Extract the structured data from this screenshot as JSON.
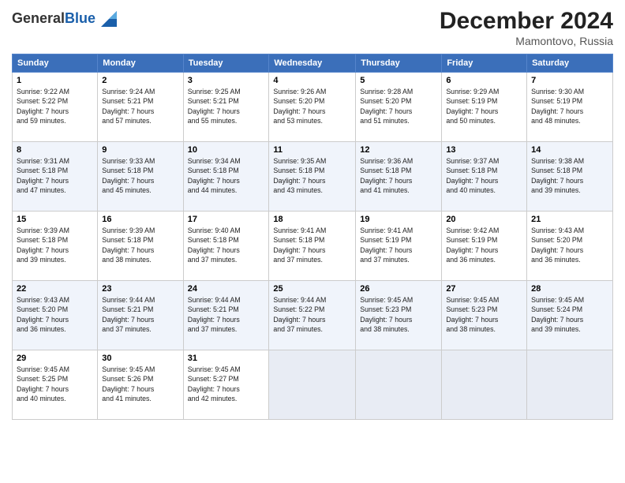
{
  "logo": {
    "general": "General",
    "blue": "Blue"
  },
  "title": "December 2024",
  "location": "Mamontovo, Russia",
  "days_of_week": [
    "Sunday",
    "Monday",
    "Tuesday",
    "Wednesday",
    "Thursday",
    "Friday",
    "Saturday"
  ],
  "weeks": [
    [
      {
        "day": "1",
        "sunrise": "9:22 AM",
        "sunset": "5:22 PM",
        "daylight_hours": "7",
        "daylight_minutes": "59"
      },
      {
        "day": "2",
        "sunrise": "9:24 AM",
        "sunset": "5:21 PM",
        "daylight_hours": "7",
        "daylight_minutes": "57"
      },
      {
        "day": "3",
        "sunrise": "9:25 AM",
        "sunset": "5:21 PM",
        "daylight_hours": "7",
        "daylight_minutes": "55"
      },
      {
        "day": "4",
        "sunrise": "9:26 AM",
        "sunset": "5:20 PM",
        "daylight_hours": "7",
        "daylight_minutes": "53"
      },
      {
        "day": "5",
        "sunrise": "9:28 AM",
        "sunset": "5:20 PM",
        "daylight_hours": "7",
        "daylight_minutes": "51"
      },
      {
        "day": "6",
        "sunrise": "9:29 AM",
        "sunset": "5:19 PM",
        "daylight_hours": "7",
        "daylight_minutes": "50"
      },
      {
        "day": "7",
        "sunrise": "9:30 AM",
        "sunset": "5:19 PM",
        "daylight_hours": "7",
        "daylight_minutes": "48"
      }
    ],
    [
      {
        "day": "8",
        "sunrise": "9:31 AM",
        "sunset": "5:18 PM",
        "daylight_hours": "7",
        "daylight_minutes": "47"
      },
      {
        "day": "9",
        "sunrise": "9:33 AM",
        "sunset": "5:18 PM",
        "daylight_hours": "7",
        "daylight_minutes": "45"
      },
      {
        "day": "10",
        "sunrise": "9:34 AM",
        "sunset": "5:18 PM",
        "daylight_hours": "7",
        "daylight_minutes": "44"
      },
      {
        "day": "11",
        "sunrise": "9:35 AM",
        "sunset": "5:18 PM",
        "daylight_hours": "7",
        "daylight_minutes": "43"
      },
      {
        "day": "12",
        "sunrise": "9:36 AM",
        "sunset": "5:18 PM",
        "daylight_hours": "7",
        "daylight_minutes": "41"
      },
      {
        "day": "13",
        "sunrise": "9:37 AM",
        "sunset": "5:18 PM",
        "daylight_hours": "7",
        "daylight_minutes": "40"
      },
      {
        "day": "14",
        "sunrise": "9:38 AM",
        "sunset": "5:18 PM",
        "daylight_hours": "7",
        "daylight_minutes": "39"
      }
    ],
    [
      {
        "day": "15",
        "sunrise": "9:39 AM",
        "sunset": "5:18 PM",
        "daylight_hours": "7",
        "daylight_minutes": "39"
      },
      {
        "day": "16",
        "sunrise": "9:39 AM",
        "sunset": "5:18 PM",
        "daylight_hours": "7",
        "daylight_minutes": "38"
      },
      {
        "day": "17",
        "sunrise": "9:40 AM",
        "sunset": "5:18 PM",
        "daylight_hours": "7",
        "daylight_minutes": "37"
      },
      {
        "day": "18",
        "sunrise": "9:41 AM",
        "sunset": "5:18 PM",
        "daylight_hours": "7",
        "daylight_minutes": "37"
      },
      {
        "day": "19",
        "sunrise": "9:41 AM",
        "sunset": "5:19 PM",
        "daylight_hours": "7",
        "daylight_minutes": "37"
      },
      {
        "day": "20",
        "sunrise": "9:42 AM",
        "sunset": "5:19 PM",
        "daylight_hours": "7",
        "daylight_minutes": "36"
      },
      {
        "day": "21",
        "sunrise": "9:43 AM",
        "sunset": "5:20 PM",
        "daylight_hours": "7",
        "daylight_minutes": "36"
      }
    ],
    [
      {
        "day": "22",
        "sunrise": "9:43 AM",
        "sunset": "5:20 PM",
        "daylight_hours": "7",
        "daylight_minutes": "36"
      },
      {
        "day": "23",
        "sunrise": "9:44 AM",
        "sunset": "5:21 PM",
        "daylight_hours": "7",
        "daylight_minutes": "37"
      },
      {
        "day": "24",
        "sunrise": "9:44 AM",
        "sunset": "5:21 PM",
        "daylight_hours": "7",
        "daylight_minutes": "37"
      },
      {
        "day": "25",
        "sunrise": "9:44 AM",
        "sunset": "5:22 PM",
        "daylight_hours": "7",
        "daylight_minutes": "37"
      },
      {
        "day": "26",
        "sunrise": "9:45 AM",
        "sunset": "5:23 PM",
        "daylight_hours": "7",
        "daylight_minutes": "38"
      },
      {
        "day": "27",
        "sunrise": "9:45 AM",
        "sunset": "5:23 PM",
        "daylight_hours": "7",
        "daylight_minutes": "38"
      },
      {
        "day": "28",
        "sunrise": "9:45 AM",
        "sunset": "5:24 PM",
        "daylight_hours": "7",
        "daylight_minutes": "39"
      }
    ],
    [
      {
        "day": "29",
        "sunrise": "9:45 AM",
        "sunset": "5:25 PM",
        "daylight_hours": "7",
        "daylight_minutes": "40"
      },
      {
        "day": "30",
        "sunrise": "9:45 AM",
        "sunset": "5:26 PM",
        "daylight_hours": "7",
        "daylight_minutes": "41"
      },
      {
        "day": "31",
        "sunrise": "9:45 AM",
        "sunset": "5:27 PM",
        "daylight_hours": "7",
        "daylight_minutes": "42"
      },
      null,
      null,
      null,
      null
    ]
  ],
  "labels": {
    "sunrise": "Sunrise:",
    "sunset": "Sunset:",
    "daylight": "Daylight:"
  }
}
